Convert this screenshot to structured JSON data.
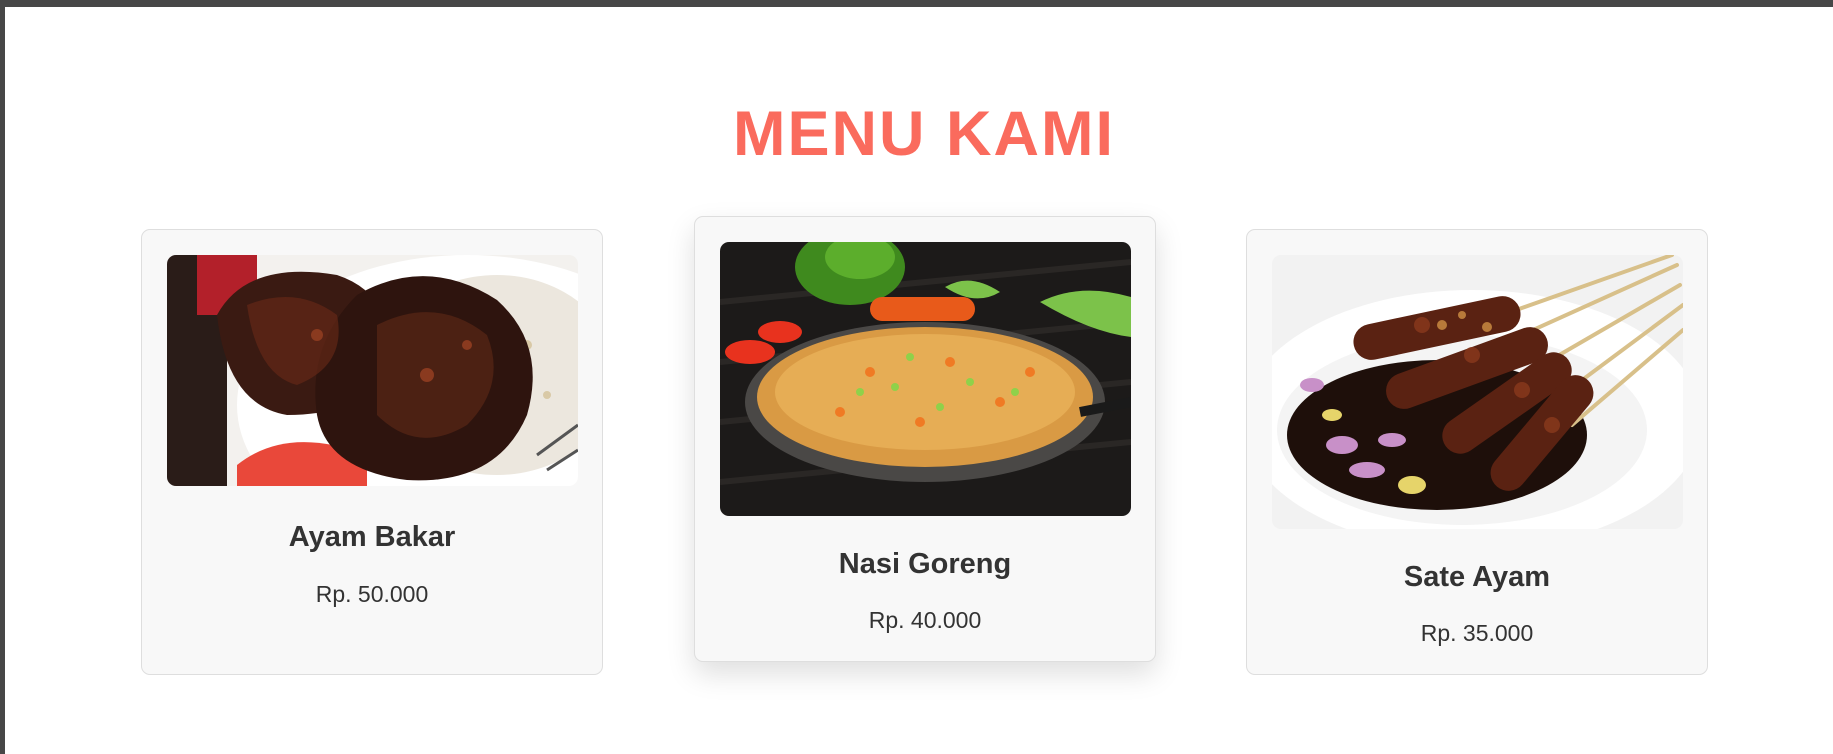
{
  "section": {
    "title": "MENU KAMI"
  },
  "menu": {
    "items": [
      {
        "name": "Ayam Bakar",
        "price": "Rp. 50.000",
        "image": "grilled-chicken-photo"
      },
      {
        "name": "Nasi Goreng",
        "price": "Rp. 40.000",
        "image": "fried-rice-photo"
      },
      {
        "name": "Sate Ayam",
        "price": "Rp. 35.000",
        "image": "chicken-satay-photo"
      }
    ]
  },
  "colors": {
    "title": "#fa6b5d",
    "card_background": "#f8f8f8",
    "card_border": "#dedede",
    "text": "#333333",
    "frame": "#474747"
  }
}
